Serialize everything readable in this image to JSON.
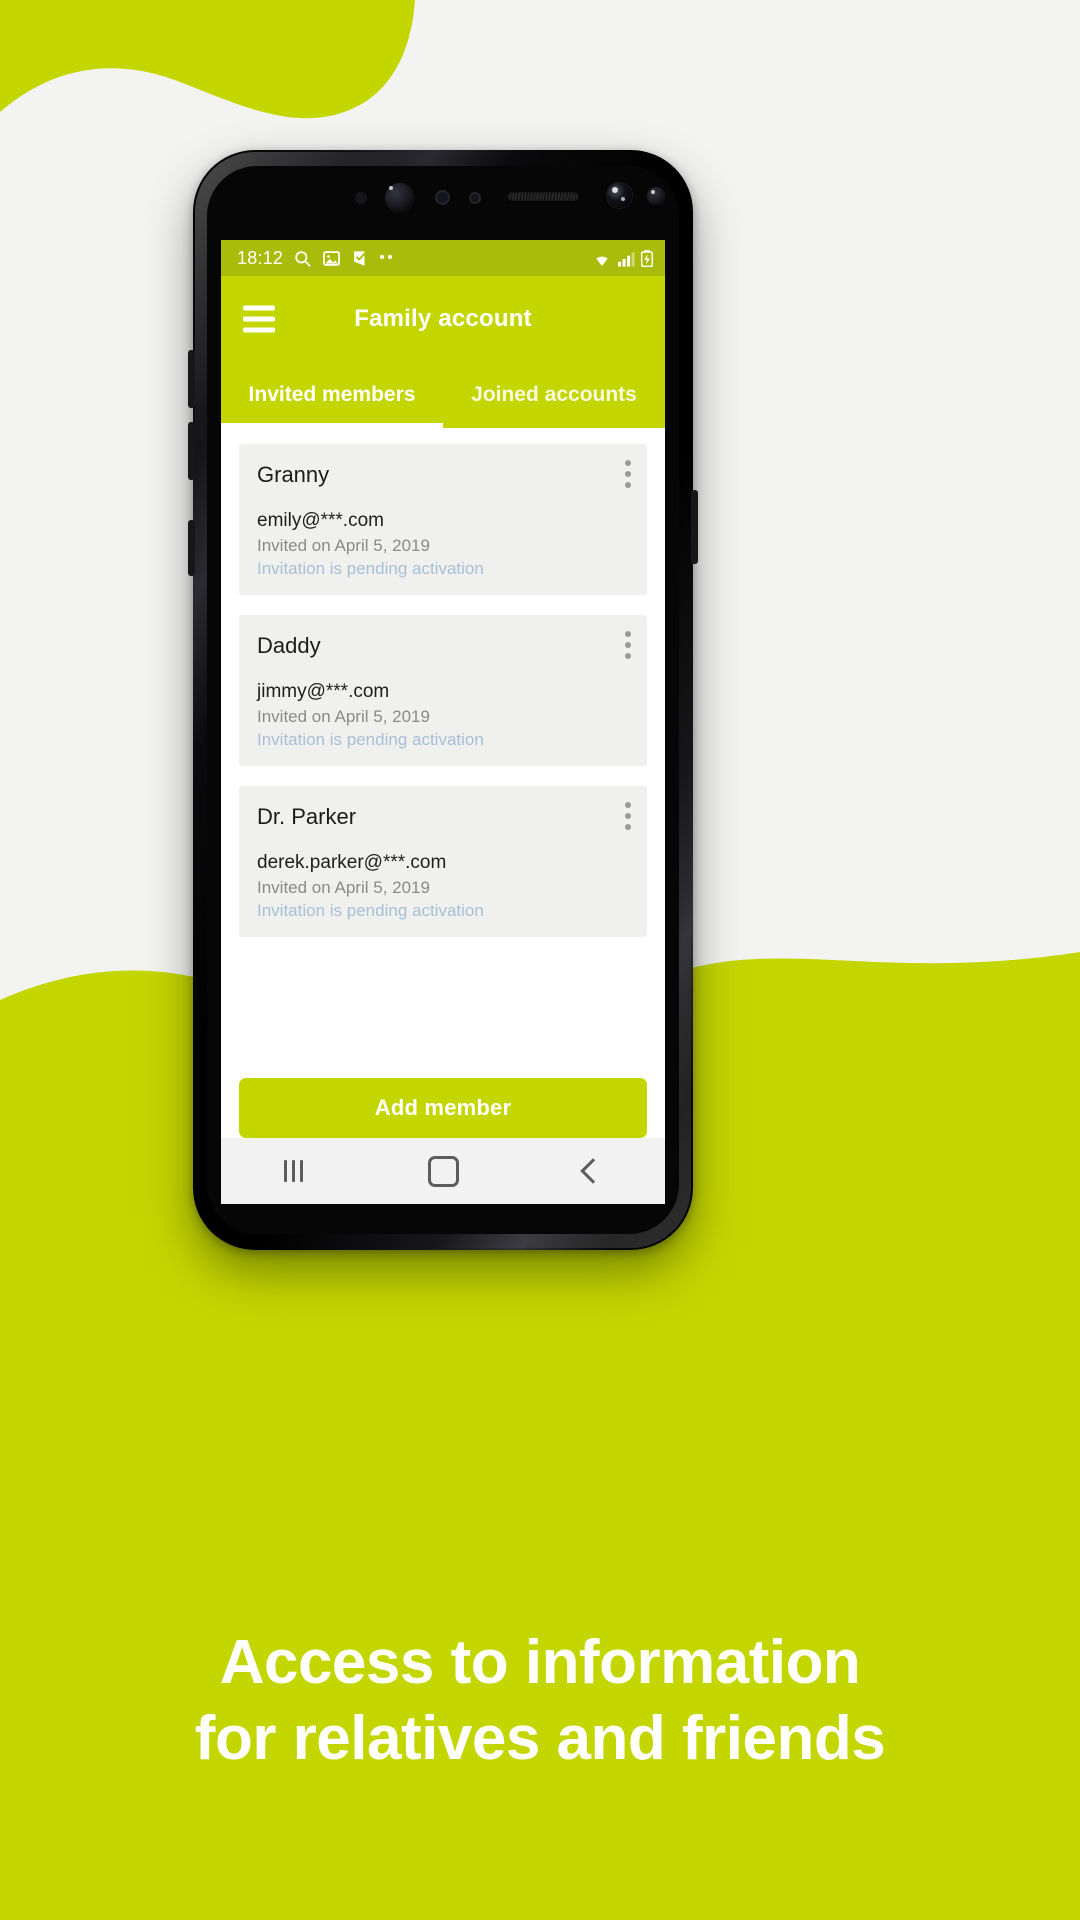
{
  "theme": {
    "accent": "#c4d600",
    "accent_dark": "#a9bc0b",
    "page_bg": "#f3f3f1",
    "card_bg": "#f0f0ef",
    "status_text": "#a8c0d6"
  },
  "statusbar": {
    "time": "18:12",
    "left_icons": [
      "search-icon",
      "image-icon",
      "checklist-icon",
      "more-dots-icon"
    ],
    "right_icons": [
      "wifi-icon",
      "signal-icon",
      "battery-icon"
    ]
  },
  "appbar": {
    "menu_icon": "hamburger-menu-icon",
    "title": "Family account"
  },
  "tabs": [
    {
      "label": "Invited members",
      "active": true
    },
    {
      "label": "Joined accounts",
      "active": false
    }
  ],
  "members": [
    {
      "name": "Granny",
      "email": "emily@***.com",
      "invited": "Invited on April 5, 2019",
      "status": "Invitation is pending activation",
      "menu_icon": "kebab-menu-icon"
    },
    {
      "name": "Daddy",
      "email": "jimmy@***.com",
      "invited": "Invited on April 5, 2019",
      "status": "Invitation is pending activation",
      "menu_icon": "kebab-menu-icon"
    },
    {
      "name": "Dr. Parker",
      "email": "derek.parker@***.com",
      "invited": "Invited on April 5, 2019",
      "status": "Invitation is pending activation",
      "menu_icon": "kebab-menu-icon"
    }
  ],
  "cta": {
    "label": "Add member"
  },
  "navbar": {
    "recent_icon": "recent-apps-icon",
    "home_icon": "home-icon",
    "back_icon": "back-icon"
  },
  "caption": {
    "line1": "Access to information",
    "line2": "for relatives and friends"
  }
}
